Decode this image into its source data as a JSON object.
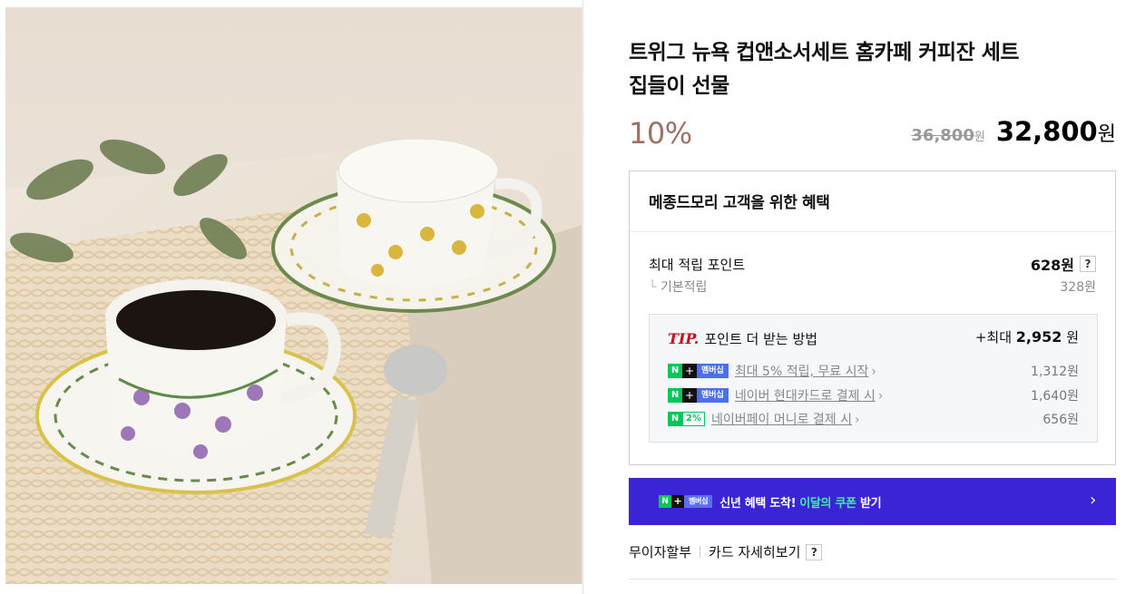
{
  "product": {
    "title_line1": "트위그 뉴욕 컵앤소서세트 홈카페 커피잔 세트",
    "title_line2": "집들이 선물",
    "discount": "10%",
    "original_price": "36,800",
    "original_unit": "원",
    "sale_price": "32,800",
    "sale_unit": "원"
  },
  "benefit": {
    "heading": "메종드모리 고객을 위한 혜택",
    "max_points_label": "최대 적립 포인트",
    "max_points_value": "628원",
    "base_label": "기본적립",
    "base_value": "328원",
    "help": "?",
    "tip": {
      "tip_word": "TIP.",
      "title": "포인트 더 받는 방법",
      "max_prefix": "+최대",
      "max_value": "2,952",
      "max_unit": "원",
      "items": [
        {
          "label": "최대 5% 적립, 무료 시작",
          "amount": "1,312원"
        },
        {
          "label": "네이버 현대카드로 결제 시",
          "amount": "1,640원"
        },
        {
          "label": "네이버페이 머니로 결제 시",
          "amount": "656원"
        }
      ],
      "badge_membership": "멤버십",
      "badge_pct": "2%"
    }
  },
  "banner": {
    "badge": "멤버십",
    "text": "신년 혜택 도착!",
    "highlight": "이달의 쿠폰",
    "suffix": " 받기",
    "arrow": "›"
  },
  "installment": {
    "label": "무이자할부",
    "card_detail": "카드 자세히보기",
    "help": "?"
  },
  "colors": {
    "discount": "#9a7164",
    "banner_bg": "#3b24d5",
    "banner_highlight": "#3ef0a5",
    "naver_green": "#03c75a",
    "tip_red": "#d0021b"
  }
}
